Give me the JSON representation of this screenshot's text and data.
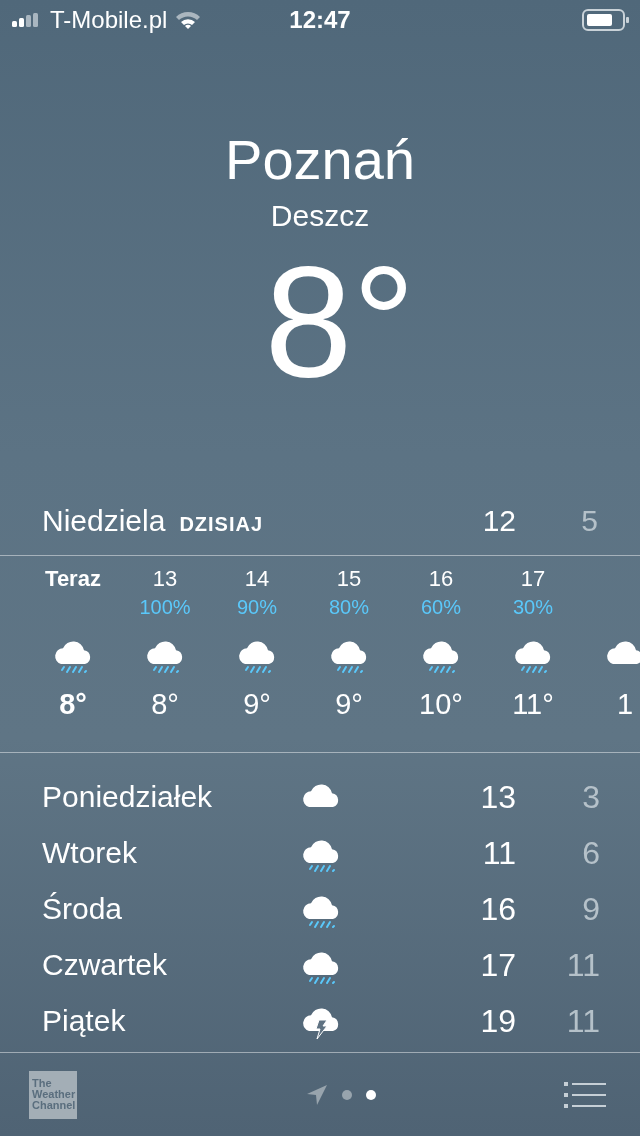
{
  "status_bar": {
    "carrier": "T-Mobile.pl",
    "time": "12:47"
  },
  "location": {
    "city": "Poznań",
    "condition": "Deszcz",
    "temperature": "8°"
  },
  "today": {
    "day": "Niedziela",
    "label": "DZISIAJ",
    "high": "12",
    "low": "5"
  },
  "hourly": [
    {
      "time": "Teraz",
      "now": true,
      "kind": "rain",
      "temp": "8°"
    },
    {
      "time": "13",
      "now": false,
      "chance": "100%",
      "kind": "rain",
      "temp": "8°"
    },
    {
      "time": "14",
      "now": false,
      "chance": "90%",
      "kind": "rain",
      "temp": "9°"
    },
    {
      "time": "15",
      "now": false,
      "chance": "80%",
      "kind": "rain",
      "temp": "9°"
    },
    {
      "time": "16",
      "now": false,
      "chance": "60%",
      "kind": "rain",
      "temp": "10°"
    },
    {
      "time": "17",
      "now": false,
      "chance": "30%",
      "kind": "rain",
      "temp": "11°"
    },
    {
      "now": false,
      "kind": "cloud",
      "temp": "1"
    }
  ],
  "daily": [
    {
      "day": "Poniedziałek",
      "kind": "cloud",
      "high": "13",
      "low": "3"
    },
    {
      "day": "Wtorek",
      "kind": "rain",
      "high": "11",
      "low": "6"
    },
    {
      "day": "Środa",
      "kind": "rain",
      "high": "16",
      "low": "9"
    },
    {
      "day": "Czwartek",
      "kind": "rain",
      "high": "17",
      "low": "11"
    },
    {
      "day": "Piątek",
      "kind": "storm",
      "high": "19",
      "low": "11"
    }
  ],
  "bottom_bar": {
    "logo": [
      "The",
      "Weather",
      "Channel"
    ],
    "pages": [
      {
        "kind": "location",
        "selected": false
      },
      {
        "kind": "dot",
        "selected": false
      },
      {
        "kind": "dot",
        "selected": true
      }
    ]
  }
}
